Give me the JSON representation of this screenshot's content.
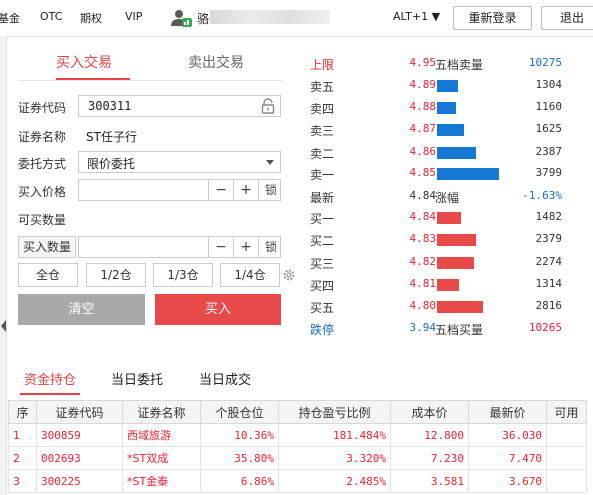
{
  "topbar": {
    "nav": [
      "基金",
      "OTC",
      "期权",
      "VIP"
    ],
    "user_name": "骆",
    "alt_select": "ALT+1 ▼",
    "relogin_label": "重新登录",
    "logout_label": "退出"
  },
  "trade_tabs": {
    "buy": "买入交易",
    "sell": "卖出交易"
  },
  "form": {
    "code_label": "证券代码",
    "code_value": "300311",
    "name_label": "证券名称",
    "name_value": "ST任子行",
    "order_type_label": "委托方式",
    "order_type_value": "限价委托",
    "price_label": "买入价格",
    "price_value": "",
    "max_qty_label": "可买数量",
    "qty_button_label": "买入数量",
    "qty_value": "",
    "minus": "−",
    "plus": "+",
    "lock": "锁",
    "positions": [
      "全仓",
      "1/2仓",
      "1/3仓",
      "1/4仓"
    ],
    "clear_label": "清空",
    "buy_label": "买入"
  },
  "quote": {
    "upper": {
      "label": "上限",
      "price": "4.95",
      "title": "五档卖量",
      "value": "10275"
    },
    "asks": [
      {
        "label": "卖五",
        "price": "4.89",
        "vol": "1304",
        "bar": 0.34
      },
      {
        "label": "卖四",
        "price": "4.88",
        "vol": "1160",
        "bar": 0.3
      },
      {
        "label": "卖三",
        "price": "4.87",
        "vol": "1625",
        "bar": 0.43
      },
      {
        "label": "卖二",
        "price": "4.86",
        "vol": "2387",
        "bar": 0.63
      },
      {
        "label": "卖一",
        "price": "4.85",
        "vol": "3799",
        "bar": 1.0
      }
    ],
    "last": {
      "label": "最新",
      "price": "4.84",
      "title": "涨幅",
      "value": "-1.63%"
    },
    "bids": [
      {
        "label": "买一",
        "price": "4.84",
        "vol": "1482",
        "bar": 0.39
      },
      {
        "label": "买二",
        "price": "4.83",
        "vol": "2379",
        "bar": 0.63
      },
      {
        "label": "买三",
        "price": "4.82",
        "vol": "2274",
        "bar": 0.6
      },
      {
        "label": "买四",
        "price": "4.81",
        "vol": "1314",
        "bar": 0.35
      },
      {
        "label": "买五",
        "price": "4.80",
        "vol": "2816",
        "bar": 0.74
      }
    ],
    "lower": {
      "label": "跌停",
      "price": "3.94",
      "title": "五档买量",
      "value": "10265"
    },
    "ask_color": "#1478d4",
    "bid_color": "#e84a4a"
  },
  "bottom_tabs": [
    "资金持仓",
    "当日委托",
    "当日成交"
  ],
  "holdings": {
    "headers": [
      "序",
      "证券代码",
      "证券名称",
      "个股仓位",
      "持仓盈亏比例",
      "成本价",
      "最新价",
      "可用"
    ],
    "rows": [
      [
        "1",
        "300859",
        "西域旅游",
        "10.36%",
        "181.484%",
        "12.800",
        "36.030",
        ""
      ],
      [
        "2",
        "002693",
        "*ST双成",
        "35.80%",
        "3.320%",
        "7.230",
        "7.470",
        ""
      ],
      [
        "3",
        "300225",
        "*ST金泰",
        "6.86%",
        "2.485%",
        "3.581",
        "3.670",
        ""
      ]
    ]
  }
}
